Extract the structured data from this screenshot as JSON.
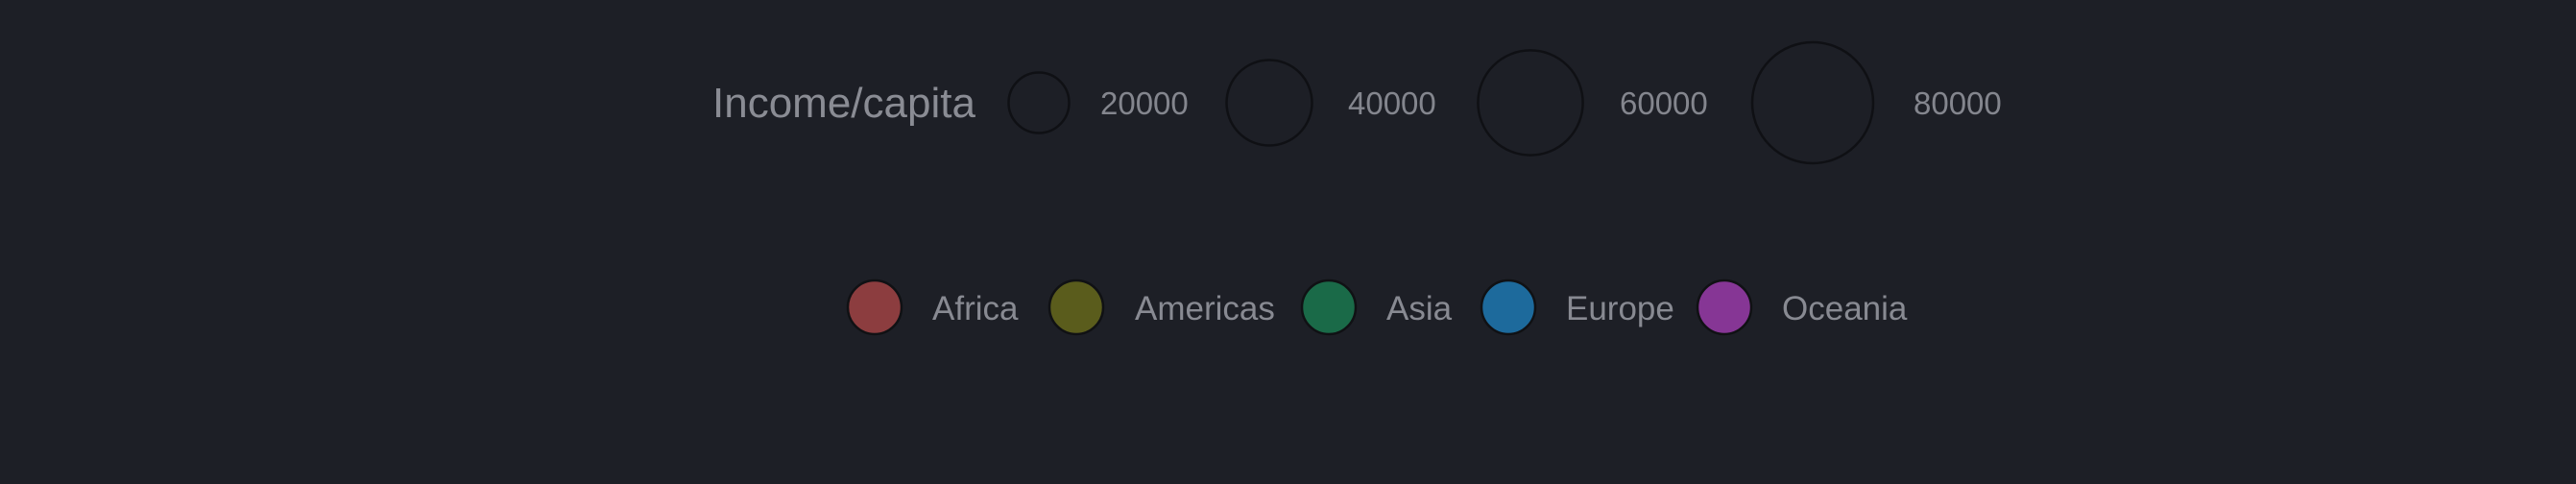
{
  "chart_data": {
    "type": "legend",
    "size_legend": {
      "title": "Income/capita",
      "stroke_color": "#0f1014",
      "entries": [
        {
          "value": 20000,
          "label": "20000"
        },
        {
          "value": 40000,
          "label": "40000"
        },
        {
          "value": 60000,
          "label": "60000"
        },
        {
          "value": 80000,
          "label": "80000"
        }
      ]
    },
    "color_legend": {
      "entries": [
        {
          "label": "Africa",
          "color": "#8c3d3f"
        },
        {
          "label": "Americas",
          "color": "#5a5c1c"
        },
        {
          "label": "Asia",
          "color": "#1a6a48"
        },
        {
          "label": "Europe",
          "color": "#1d6a9c"
        },
        {
          "label": "Oceania",
          "color": "#863695"
        }
      ]
    }
  }
}
